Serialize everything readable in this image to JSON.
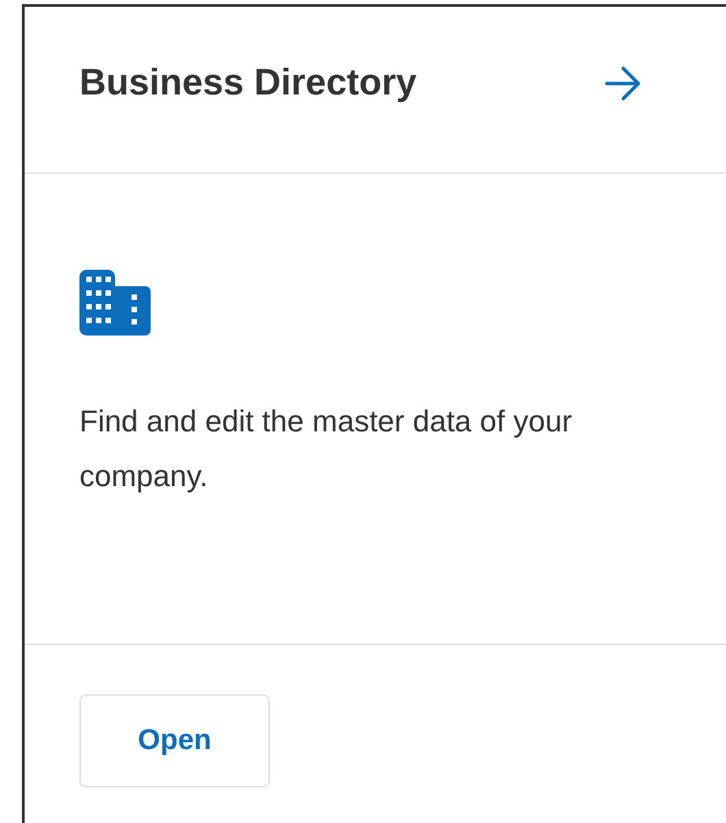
{
  "card": {
    "title": "Business Directory",
    "description": "Find and edit the master data of your company.",
    "button": "Open"
  }
}
